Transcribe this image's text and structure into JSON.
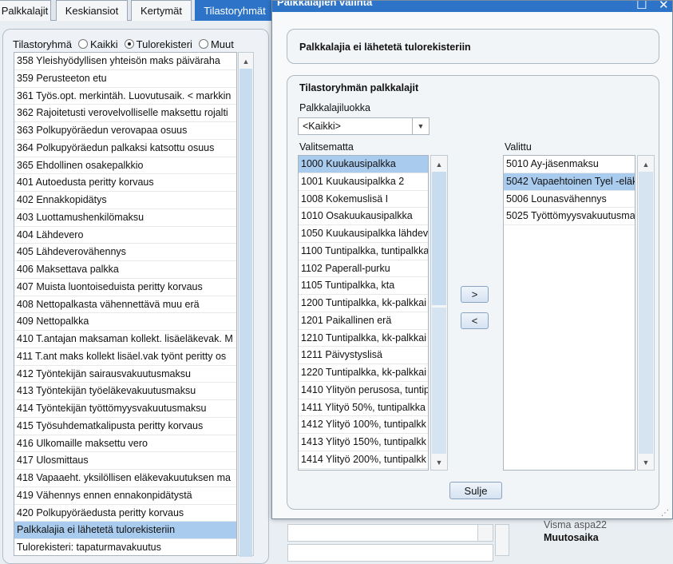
{
  "tabs": [
    {
      "label": "Palkkalajit"
    },
    {
      "label": "Keskiansiot"
    },
    {
      "label": "Kertymät"
    },
    {
      "label": "Tilastoryhmät"
    }
  ],
  "filter": {
    "label": "Tilastoryhmä",
    "options": [
      "Kaikki",
      "Tulorekisteri",
      "Muut"
    ],
    "selected": "Tulorekisteri"
  },
  "left_list": [
    "358 Yleishyödyllisen yhteisön maks päiväraha",
    "359 Perusteeton etu",
    "361 Työs.opt. merkintäh. Luovutusaik. < markkin",
    "362 Rajoitetusti verovelvolliselle maksettu rojalti",
    "363 Polkupyöräedun verovapaa osuus",
    "364 Polkupyöräedun palkaksi katsottu osuus",
    "365 Ehdollinen osakepalkkio",
    "401 Autoedusta peritty korvaus",
    "402 Ennakkopidätys",
    "403 Luottamushenkilömaksu",
    "404 Lähdevero",
    "405 Lähdeverovähennys",
    "406 Maksettava palkka",
    "407 Muista luontoiseduista peritty korvaus",
    "408 Nettopalkasta vähennettävä muu erä",
    "409 Nettopalkka",
    "410 T.antajan maksaman kollekt. lisäeläkevak. M",
    "411 T.ant maks kollekt lisäel.vak työnt peritty os",
    "412 Työntekijän sairausvakuutusmaksu",
    "413 Työntekijän työeläkevakuutusmaksu",
    "414 Työntekijän työttömyysvakuutusmaksu",
    "415 Työsuhdematkalipusta peritty korvaus",
    "416 Ulkomaille maksettu vero",
    "417 Ulosmittaus",
    "418 Vapaaeht. yksilöllisen eläkevakuutuksen ma",
    "419 Vähennys ennen ennakonpidätystä",
    "420 Polkupyöräedusta peritty korvaus",
    "Palkkalajia ei lähetetä tulorekisteriin",
    "Tulorekisteri: tapaturmavakuutus"
  ],
  "dialog": {
    "title": "Palkkalajien valinta",
    "maximize_glyph": "☐",
    "close_glyph": "✕",
    "header_group_text": "Palkkalajia ei lähetetä tulorekisteriin",
    "group_title": "Tilastoryhmän palkkalajit",
    "class_label": "Palkkalajiluokka",
    "class_value": "<Kaikki>",
    "unselected_label": "Valitsematta",
    "selected_label": "Valittu",
    "unselected_items": [
      "1000 Kuukausipalkka",
      "1001 Kuukausipalkka 2",
      "1008 Kokemuslisä I",
      "1010 Osakuukausipalkka",
      "1050 Kuukausipalkka lähdev",
      "1100 Tuntipalkka, tuntipalkka",
      "1102 Paperall-purku",
      "1105 Tuntipalkka, kta",
      "1200 Tuntipalkka, kk-palkkai",
      "1201 Paikallinen erä",
      "1210 Tuntipalkka, kk-palkkai",
      "1211 Päivystyslisä",
      "1220 Tuntipalkka, kk-palkkai",
      "1410 Ylityön perusosa, tuntip",
      "1411 Ylityö 50%, tuntipalkka",
      "1412 Ylityö 100%, tuntipalkk",
      "1413 Ylityö 150%, tuntipalkk",
      "1414 Ylityö 200%, tuntipalkk"
    ],
    "selected_items": [
      "5010 Ay-jäsenmaksu",
      "5042 Vapaehtoinen Tyel -eläk",
      "5006 Lounasvähennys",
      "5025 Työttömyysvakuutusma"
    ],
    "add_button": ">",
    "remove_button": "<",
    "close_button": "Sulje"
  },
  "background": {
    "text1": "Visma aspa22",
    "text2": "Muutosaika"
  },
  "colors": {
    "accent": "#2d74c9",
    "selection": "#a9cbee"
  }
}
